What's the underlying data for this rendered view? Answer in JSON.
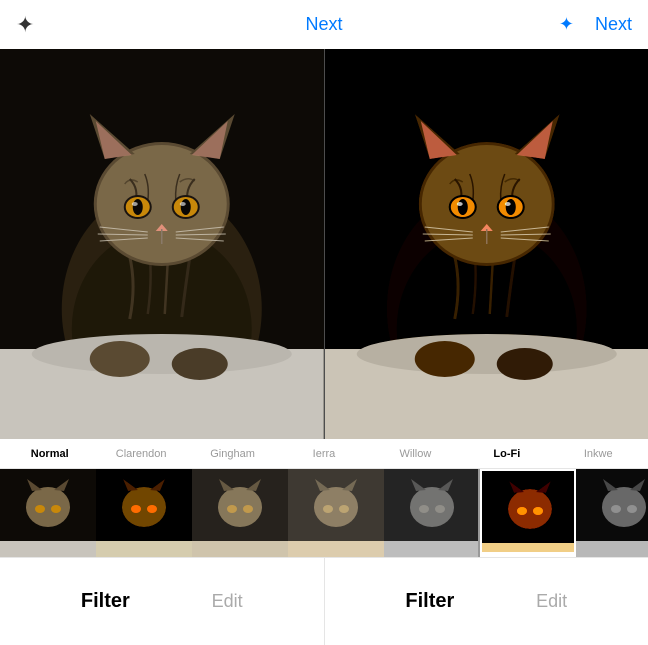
{
  "header": {
    "title": "Next",
    "next_label": "Next",
    "wand_icon": "✦"
  },
  "filters": {
    "labels": [
      {
        "id": "normal",
        "label": "Normal",
        "active": true,
        "bold": true
      },
      {
        "id": "clarendon",
        "label": "Clarendon",
        "active": false
      },
      {
        "id": "gingham",
        "label": "Gingham",
        "active": false
      },
      {
        "id": "sierra",
        "label": "Ierra",
        "active": false
      },
      {
        "id": "willow",
        "label": "Willow",
        "active": false
      },
      {
        "id": "lofi",
        "label": "Lo-Fi",
        "active": false,
        "bold": true
      },
      {
        "id": "inkwell",
        "label": "Inkwe",
        "active": false
      }
    ]
  },
  "bottom_tabs": {
    "left": {
      "filter_label": "Filter",
      "edit_label": "Edit"
    },
    "right": {
      "filter_label": "Filter",
      "edit_label": "Edit"
    }
  }
}
